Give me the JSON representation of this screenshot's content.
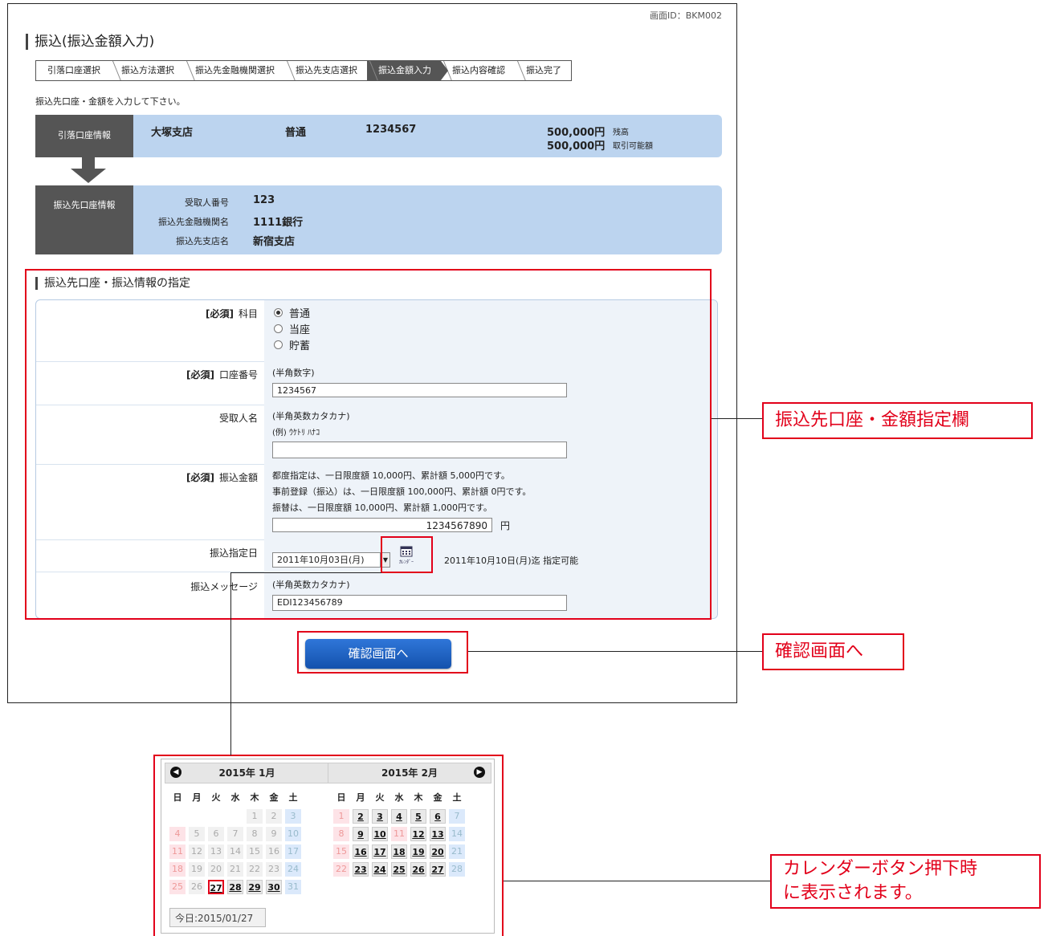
{
  "screen_id": "画面ID：BKM002",
  "page_title": "振込(振込金額入力)",
  "steps": [
    {
      "label": "引落口座選択",
      "active": false
    },
    {
      "label": "振込方法選択",
      "active": false
    },
    {
      "label": "振込先金融機関選択",
      "active": false
    },
    {
      "label": "振込先支店選択",
      "active": false
    },
    {
      "label": "振込金額入力",
      "active": true
    },
    {
      "label": "振込内容確認",
      "active": false
    },
    {
      "label": "振込完了",
      "active": false
    }
  ],
  "instruction": "振込先口座・金額を入力して下さい。",
  "debit_account": {
    "label": "引落口座情報",
    "branch": "大塚支店",
    "type": "普通",
    "number": "1234567",
    "balance": "500,000円",
    "balance_label": "残高",
    "available": "500,000円",
    "available_label": "取引可能額"
  },
  "payee_account": {
    "label": "振込先口座情報",
    "payee_no_label": "受取人番号",
    "payee_no": "123",
    "bank_label": "振込先金融機関名",
    "bank": "1111銀行",
    "branch_label": "振込先支店名",
    "branch": "新宿支店"
  },
  "section_title": "振込先口座・振込情報の指定",
  "required_mark": "[必須]",
  "form": {
    "subject_label": "科目",
    "subject_options": [
      "普通",
      "当座",
      "貯蓄"
    ],
    "subject_selected": 0,
    "account_no_label": "口座番号",
    "account_no_hint": "(半角数字)",
    "account_no_value": "1234567",
    "payee_name_label": "受取人名",
    "payee_name_hint": "(半角英数カタカナ)",
    "payee_name_example": "(例) ｳｹﾄﾘ ﾊﾅｺ",
    "payee_name_value": "",
    "amount_label": "振込金額",
    "amount_note1": "都度指定は、一日限度額 10,000円、累計額 5,000円です。",
    "amount_note2": "事前登録（振込）は、一日限度額 100,000円、累計額 0円です。",
    "amount_note3": "振替は、一日限度額 10,000円、累計額 1,000円です。",
    "amount_value": "1234567890",
    "amount_unit": "円",
    "date_label": "振込指定日",
    "date_value": "2011年10月03日(月)",
    "calendar_icon_text": "ｶﾚﾝﾀﾞｰ",
    "date_note": "2011年10月10日(月)迄 指定可能",
    "message_label": "振込メッセージ",
    "message_hint": "(半角英数カタカナ)",
    "message_value": "EDI123456789"
  },
  "confirm_button": "確認画面へ",
  "callouts": {
    "form_area": "振込先口座・金額指定欄",
    "confirm": "確認画面へ",
    "calendar_line1": "カレンダーボタン押下時",
    "calendar_line2": "に表示されます。"
  },
  "calendar": {
    "month1": "2015年 1月",
    "month2": "2015年 2月",
    "weekdays": [
      "日",
      "月",
      "火",
      "水",
      "木",
      "金",
      "土"
    ],
    "today_label": "今日:2015/01/27",
    "today_day": 27,
    "jan_first_dow": 4,
    "jan_days": 31,
    "feb_first_dow": 0,
    "feb_days": 28
  },
  "colors": {
    "accent_red": "#e2001a",
    "info_bg": "#bcd4ef",
    "label_dark": "#555555",
    "button_blue": "#1f63c4"
  }
}
